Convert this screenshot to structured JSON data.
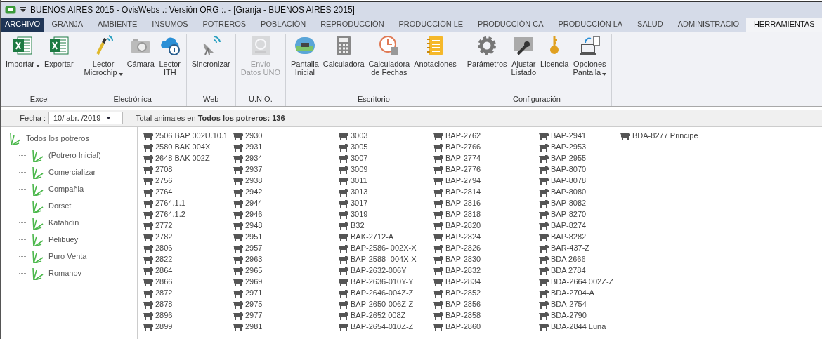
{
  "window": {
    "title": "BUENOS AIRES  2015 - OvisWebs  .: Versión ORG :. - [Granja - BUENOS AIRES  2015]"
  },
  "tabs": [
    {
      "label": "ARCHIVO",
      "kind": "file",
      "selected": false
    },
    {
      "label": "GRANJA",
      "kind": "tab",
      "selected": false
    },
    {
      "label": "AMBIENTE",
      "kind": "tab",
      "selected": false
    },
    {
      "label": "INSUMOS",
      "kind": "tab",
      "selected": false
    },
    {
      "label": "POTREROS",
      "kind": "tab",
      "selected": false
    },
    {
      "label": "POBLACIÓN",
      "kind": "tab",
      "selected": false
    },
    {
      "label": "REPRODUCCIÓN",
      "kind": "tab",
      "selected": false
    },
    {
      "label": "PRODUCCIÓN LE",
      "kind": "tab",
      "selected": false
    },
    {
      "label": "PRODUCCIÓN CA",
      "kind": "tab",
      "selected": false
    },
    {
      "label": "PRODUCCIÓN LA",
      "kind": "tab",
      "selected": false
    },
    {
      "label": "SALUD",
      "kind": "tab",
      "selected": false
    },
    {
      "label": "ADMINISTRACIÓ",
      "kind": "tab",
      "selected": false
    },
    {
      "label": "HERRAMIENTAS",
      "kind": "tab",
      "selected": true
    }
  ],
  "ribbon": [
    {
      "label": "Excel",
      "buttons": [
        {
          "label": "Importar",
          "dropdown": true,
          "disabled": false
        },
        {
          "label": "Exportar",
          "dropdown": false,
          "disabled": false
        }
      ]
    },
    {
      "label": "Electrónica",
      "buttons": [
        {
          "label": "Lector\nMicrochip",
          "dropdown": true,
          "disabled": false
        },
        {
          "label": "Cámara",
          "dropdown": false,
          "disabled": false
        },
        {
          "label": "Lector\nITH",
          "dropdown": false,
          "disabled": false
        }
      ]
    },
    {
      "label": "Web",
      "buttons": [
        {
          "label": "Sincronizar",
          "dropdown": false,
          "disabled": false
        }
      ]
    },
    {
      "label": "U.N.O.",
      "buttons": [
        {
          "label": "Envío\nDatos UNO",
          "dropdown": false,
          "disabled": true
        }
      ]
    },
    {
      "label": "Escritorio",
      "buttons": [
        {
          "label": "Pantalla\nInicial",
          "dropdown": false,
          "disabled": false
        },
        {
          "label": "Calculadora",
          "dropdown": false,
          "disabled": false
        },
        {
          "label": "Calculadora\nde Fechas",
          "dropdown": false,
          "disabled": false
        },
        {
          "label": "Anotaciones",
          "dropdown": false,
          "disabled": false
        }
      ]
    },
    {
      "label": "Configuración",
      "buttons": [
        {
          "label": "Parámetros",
          "dropdown": false,
          "disabled": false
        },
        {
          "label": "Ajustar\nListado",
          "dropdown": false,
          "disabled": false
        },
        {
          "label": "Licencia",
          "dropdown": false,
          "disabled": false
        },
        {
          "label": "Opciones\nPantalla",
          "dropdown": true,
          "disabled": false
        }
      ]
    }
  ],
  "filter": {
    "label": "Fecha :",
    "date": "10/ abr. /2019",
    "summary": "Total animales en **Todos los potreros: 136**"
  },
  "tree": {
    "label": "Todos los potreros",
    "children": [
      {
        "label": "(Potrero Inicial)"
      },
      {
        "label": "Comercializar"
      },
      {
        "label": "Compañia"
      },
      {
        "label": "Dorset"
      },
      {
        "label": "Katahdin"
      },
      {
        "label": "Pelibuey"
      },
      {
        "label": "Puro Venta"
      },
      {
        "label": "Romanov"
      }
    ]
  },
  "animals": [
    "2506 BAP 002U.10.1",
    "2580 BAK 004X",
    "2648 BAK 002Z",
    "2708",
    "2756",
    "2764",
    "2764.1.1",
    "2764.1.2",
    "2772",
    "2782",
    "2806",
    "2822",
    "2864",
    "2866",
    "2872",
    "2878",
    "2896",
    "2899",
    "2930",
    "2931",
    "2934",
    "2937",
    "2938",
    "2942",
    "2944",
    "2946",
    "2948",
    "2951",
    "2957",
    "2963",
    "2965",
    "2969",
    "2971",
    "2975",
    "2977",
    "2981",
    "3003",
    "3005",
    "3007",
    "3009",
    "3011",
    "3013",
    "3017",
    "3019",
    "B32",
    "BAK-2712-A",
    "BAP-2586- 002X-X",
    "BAP-2588 -004X-X",
    "BAP-2632-006Y",
    "BAP-2636-010Y-Y",
    "BAP-2646-004Z-Z",
    "BAP-2650-006Z-Z",
    "BAP-2652 008Z",
    "BAP-2654-010Z-Z",
    "BAP-2762",
    "BAP-2766",
    "BAP-2774",
    "BAP-2776",
    "BAP-2794",
    "BAP-2814",
    "BAP-2816",
    "BAP-2818",
    "BAP-2820",
    "BAP-2824",
    "BAP-2826",
    "BAP-2830",
    "BAP-2832",
    "BAP-2834",
    "BAP-2852",
    "BAP-2856",
    "BAP-2858",
    "BAP-2860",
    "BAP-2941",
    "BAP-2953",
    "BAP-2955",
    "BAP-8070",
    "BAP-8078",
    "BAP-8080",
    "BAP-8082",
    "BAP-8270",
    "BAP-8274",
    "BAP-8282",
    "BAR-437-Z",
    "BDA 2666",
    "BDA 2784",
    "BDA-2664 002Z-Z",
    "BDA-2704-A",
    "BDA-2754",
    "BDA-2790",
    "BDA-2844 Luna",
    "BDA-8277 Principe"
  ]
}
